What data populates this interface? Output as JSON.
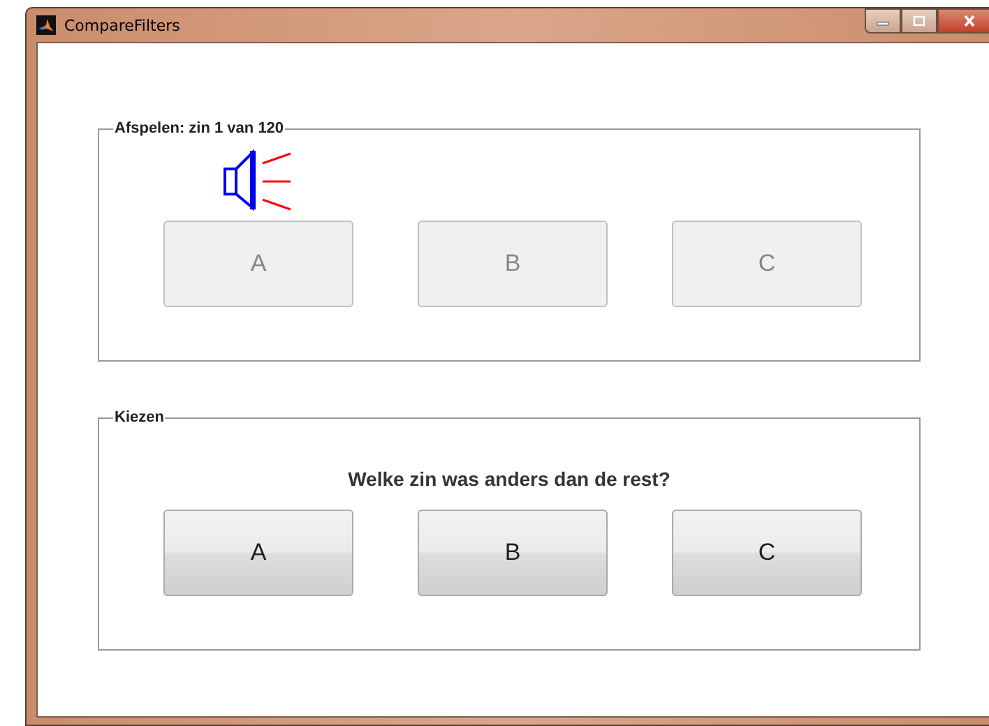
{
  "window": {
    "title": "CompareFilters"
  },
  "playback": {
    "title": "Afspelen: zin 1 van 120",
    "buttons": [
      {
        "label": "A",
        "disabled": true
      },
      {
        "label": "B",
        "disabled": true
      },
      {
        "label": "C",
        "disabled": true
      }
    ]
  },
  "choose": {
    "title": "Kiezen",
    "question": "Welke zin was anders dan de rest?",
    "buttons": [
      {
        "label": "A",
        "disabled": false
      },
      {
        "label": "B",
        "disabled": false
      },
      {
        "label": "C",
        "disabled": false
      }
    ]
  }
}
